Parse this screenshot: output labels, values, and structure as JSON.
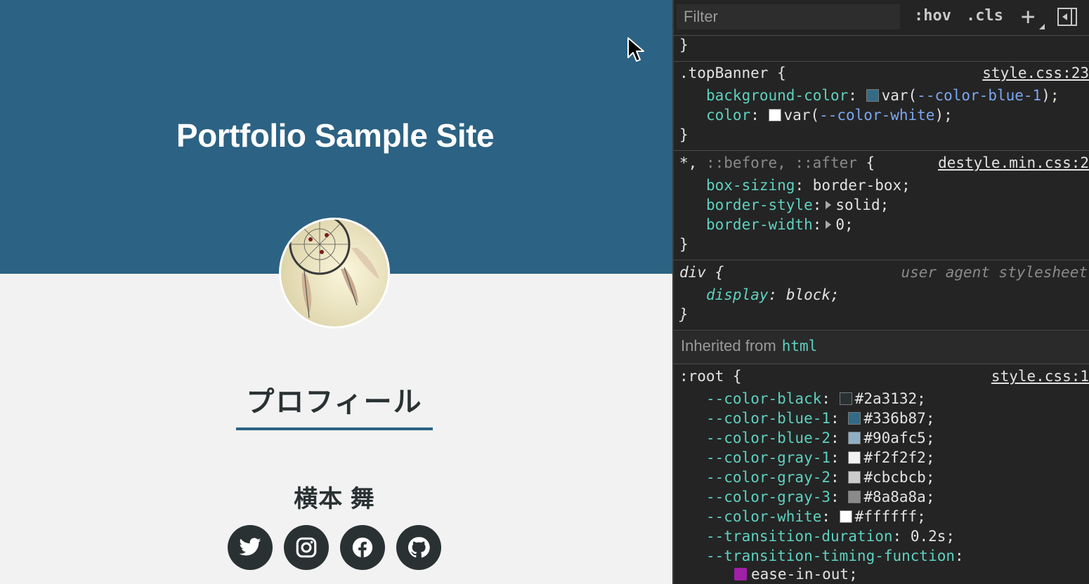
{
  "preview": {
    "site_title": "Portfolio Sample Site",
    "section_heading": "プロフィール",
    "person_name": "横本 舞",
    "social": [
      {
        "icon": "twitter-icon"
      },
      {
        "icon": "instagram-icon"
      },
      {
        "icon": "facebook-icon"
      },
      {
        "icon": "github-icon"
      }
    ],
    "colors": {
      "banner": "#2c6283",
      "page_bg": "#f2f2f2",
      "text": "#2a3132"
    }
  },
  "devtools": {
    "filter_placeholder": "Filter",
    "hov_label": ":hov",
    "cls_label": ".cls",
    "plus_label": "+",
    "top_brace": "}",
    "rules": [
      {
        "selector": ".topBanner {",
        "source": "style.css:23",
        "decls": [
          {
            "prop": "background-color",
            "var": "--color-blue-1",
            "swatch": "#336b87"
          },
          {
            "prop": "color",
            "var": "--color-white",
            "swatch": "#ffffff"
          }
        ]
      },
      {
        "selector": "*,",
        "selector_dim": " ::before, ::after",
        "selector_end": " {",
        "source": "destyle.min.css:2",
        "decls": [
          {
            "prop": "box-sizing",
            "value": "border-box;"
          },
          {
            "prop": "border-style",
            "value": "solid;"
          },
          {
            "prop": "border-width",
            "value": "0;"
          }
        ]
      },
      {
        "selector": "div {",
        "source": "user agent stylesheet",
        "decls": [
          {
            "prop": "display",
            "value": "block;"
          }
        ]
      }
    ],
    "inherited_label": "Inherited from",
    "inherited_tag": "html",
    "root_rule": {
      "selector": ":root {",
      "source": "style.css:1",
      "vars": [
        {
          "name": "--color-black",
          "value": "#2a3132;",
          "swatch": "#2a3132"
        },
        {
          "name": "--color-blue-1",
          "value": "#336b87;",
          "swatch": "#336b87"
        },
        {
          "name": "--color-blue-2",
          "value": "#90afc5;",
          "swatch": "#90afc5"
        },
        {
          "name": "--color-gray-1",
          "value": "#f2f2f2;",
          "swatch": "#f2f2f2"
        },
        {
          "name": "--color-gray-2",
          "value": "#cbcbcb;",
          "swatch": "#cbcbcb"
        },
        {
          "name": "--color-gray-3",
          "value": "#8a8a8a;",
          "swatch": "#8a8a8a"
        },
        {
          "name": "--color-white",
          "value": "#ffffff;",
          "swatch": "#ffffff"
        },
        {
          "name": "--transition-duration",
          "value": "0.2s;"
        },
        {
          "name": "--transition-timing-function",
          "value": ""
        }
      ],
      "ease_value": "ease-in-out;"
    },
    "closing_brace": "}"
  }
}
